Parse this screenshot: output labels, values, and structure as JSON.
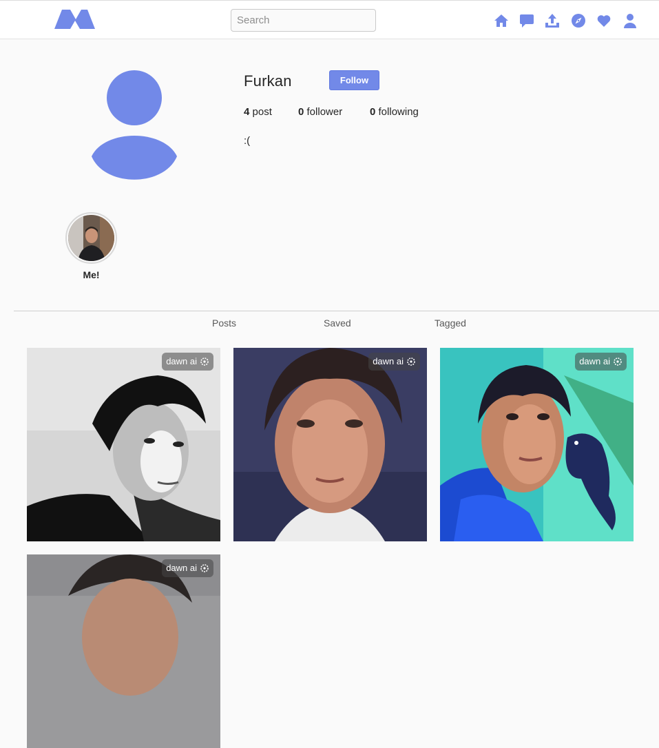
{
  "header": {
    "search_placeholder": "Search",
    "nav_icons": [
      "home-icon",
      "messages-icon",
      "upload-icon",
      "explore-icon",
      "heart-icon",
      "profile-icon"
    ],
    "accent": "#7289e8"
  },
  "profile": {
    "username": "Furkan",
    "follow_label": "Follow",
    "stats": {
      "posts_count": "4",
      "posts_label": "post",
      "followers_count": "0",
      "followers_label": "follower",
      "following_count": "0",
      "following_label": "following"
    },
    "bio": ":("
  },
  "highlights": [
    {
      "label": "Me!"
    }
  ],
  "tabs": [
    {
      "label": "Posts"
    },
    {
      "label": "Saved"
    },
    {
      "label": "Tagged"
    }
  ],
  "posts": [
    {
      "watermark": "dawn ai",
      "style": "grayscale portrait"
    },
    {
      "watermark": "dawn ai",
      "style": "painted portrait"
    },
    {
      "watermark": "dawn ai",
      "style": "portrait with fish"
    },
    {
      "watermark": "dawn ai",
      "style": "portrait"
    }
  ]
}
